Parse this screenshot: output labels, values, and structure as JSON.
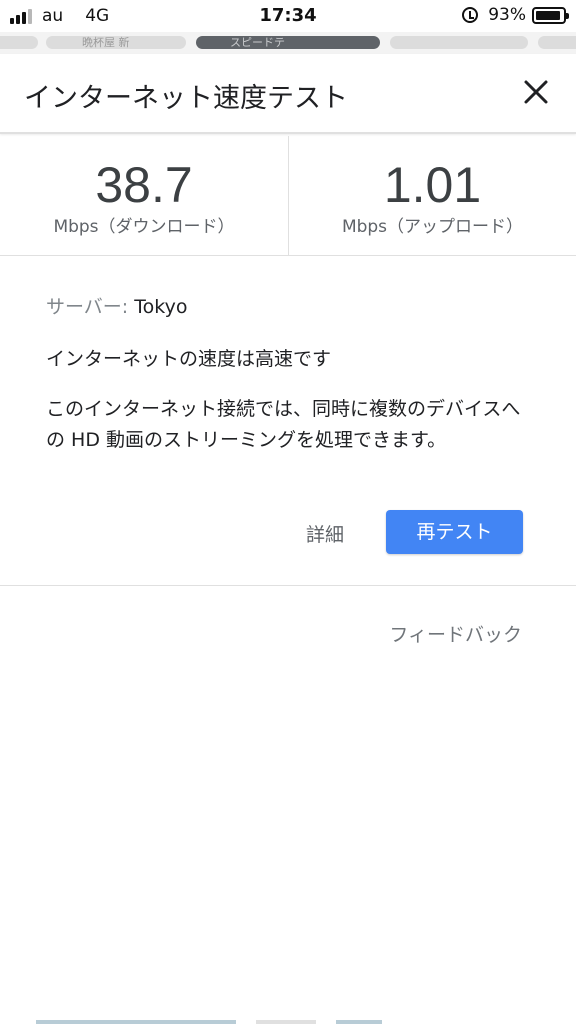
{
  "status_bar": {
    "carrier": "au",
    "network": "4G",
    "time": "17:34",
    "battery_percent": "93%",
    "battery_level": 0.93,
    "icons": [
      "signal-icon",
      "alarm-icon",
      "battery-icon"
    ]
  },
  "browser_tabs": [
    {
      "label": "晩杯屋 新",
      "active": false
    },
    {
      "label": "スピードテ",
      "active": true
    },
    {
      "label": "",
      "active": false
    },
    {
      "label": "",
      "active": false
    }
  ],
  "header": {
    "title": "インターネット速度テスト",
    "close_icon": "close-icon"
  },
  "results": {
    "download": {
      "value": "38.7",
      "unit": "Mbps（ダウンロード）"
    },
    "upload": {
      "value": "1.01",
      "unit": "Mbps（アップロード）"
    }
  },
  "details": {
    "server_label": "サーバー:",
    "server_value": "Tokyo",
    "summary": "インターネットの速度は高速です",
    "description": "このインターネット接続では、同時に複数のデバイスへの HD 動画のストリーミングを処理できます。",
    "details_link": "詳細",
    "retest_button": "再テスト"
  },
  "feedback": "フィードバック",
  "colors": {
    "accent": "#4285f4",
    "text_primary": "#202124",
    "text_secondary": "#5f6368",
    "divider": "#e0e0e0"
  }
}
